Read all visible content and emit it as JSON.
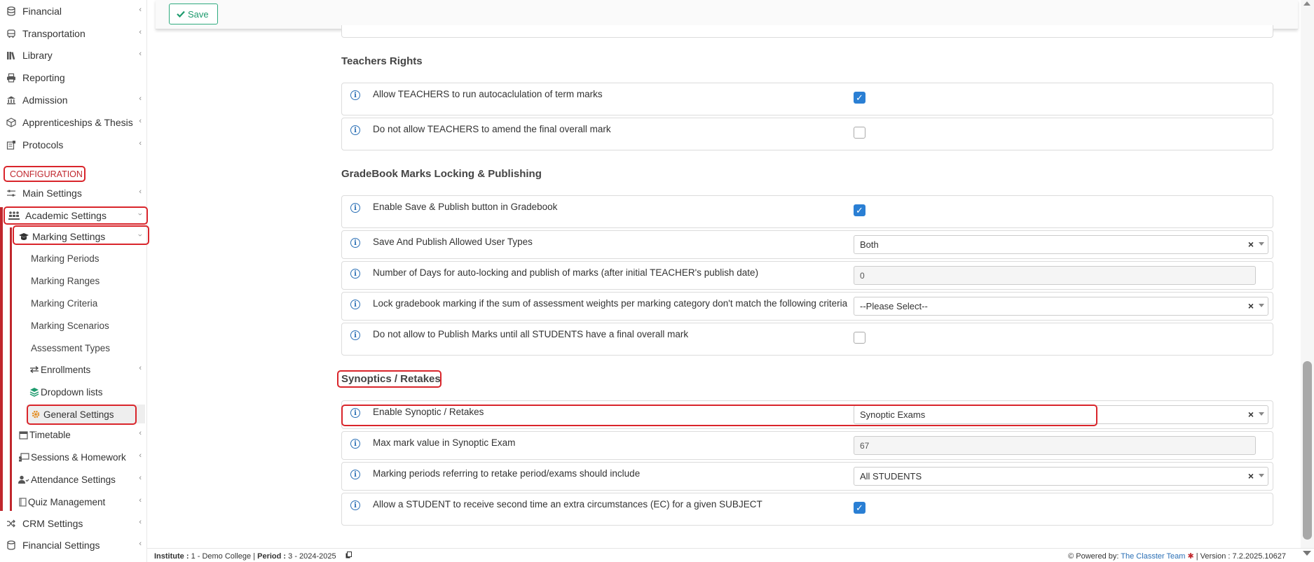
{
  "sidebar": {
    "top_items": [
      {
        "label": "Financial",
        "icon": "coins-icon"
      },
      {
        "label": "Transportation",
        "icon": "bus-icon"
      },
      {
        "label": "Library",
        "icon": "books-icon"
      },
      {
        "label": "Reporting",
        "icon": "printer-icon"
      },
      {
        "label": "Admission",
        "icon": "bank-icon"
      },
      {
        "label": "Apprenticeships & Thesis",
        "icon": "box-icon"
      },
      {
        "label": "Protocols",
        "icon": "protocol-icon"
      }
    ],
    "configuration_label": "CONFIGURATION",
    "main_settings": "Main Settings",
    "academic_settings": "Academic Settings",
    "marking_settings": "Marking Settings",
    "marking_sub": [
      "Marking Periods",
      "Marking Ranges",
      "Marking Criteria",
      "Marking Scenarios",
      "Assessment Types"
    ],
    "enrollments": "Enrollments",
    "dropdown_lists": "Dropdown lists",
    "general_settings": "General Settings",
    "timetable": "Timetable",
    "sessions_homework": "Sessions & Homework",
    "attendance_settings": "Attendance Settings",
    "quiz_management": "Quiz Management",
    "crm_settings": "CRM Settings",
    "financial_settings": "Financial Settings"
  },
  "toolbar": {
    "save_label": "Save"
  },
  "groups": {
    "teachers_rights": {
      "title": "Teachers Rights",
      "rows": [
        {
          "label": "Allow TEACHERS to run autocaclulation of term marks",
          "checked": true
        },
        {
          "label": "Do not allow TEACHERS to amend the final overall mark",
          "checked": false
        }
      ]
    },
    "gradebook": {
      "title": "GradeBook Marks Locking & Publishing",
      "row1": {
        "label": "Enable Save & Publish button in Gradebook",
        "checked": true
      },
      "row2": {
        "label": "Save And Publish Allowed User Types",
        "value": "Both"
      },
      "row3": {
        "label": "Number of Days for auto-locking and publish of marks (after initial TEACHER's publish date)",
        "value": "0"
      },
      "row4": {
        "label": "Lock gradebook marking if the sum of assessment weights per marking category don't match the following criteria",
        "value": "--Please Select--"
      },
      "row5": {
        "label": "Do not allow to Publish Marks until all STUDENTS have a final overall mark",
        "checked": false
      }
    },
    "synoptics": {
      "title": "Synoptics / Retakes",
      "row1": {
        "label": "Enable Synoptic / Retakes",
        "value": "Synoptic Exams"
      },
      "row2": {
        "label": "Max mark value in Synoptic Exam",
        "value": "67"
      },
      "row3": {
        "label": "Marking periods referring to retake period/exams should include",
        "value": "All STUDENTS"
      },
      "row4": {
        "label": "Allow a STUDENT to receive second time an extra circumstances (EC) for a given SUBJECT",
        "checked": true
      }
    }
  },
  "footer": {
    "institute_label": "Institute :",
    "institute_value": "1 - Demo College",
    "period_label": "Period :",
    "period_value": "3 - 2024-2025",
    "powered_by": "Powered by:",
    "team": "The Classter Team",
    "version": "| Version : 7.2.2025.10627"
  },
  "colors": {
    "accent_red": "#d9252b",
    "checkbox_blue": "#2a7fd4",
    "save_green": "#1e9b6e"
  }
}
